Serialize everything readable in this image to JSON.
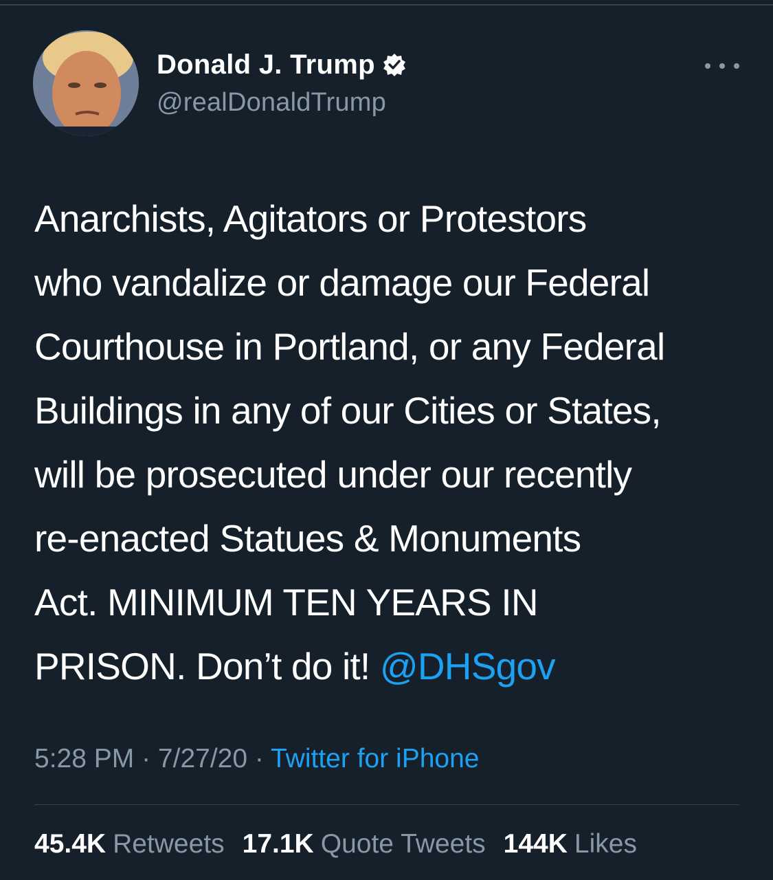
{
  "author": {
    "display_name": "Donald J. Trump",
    "handle": "@realDonaldTrump",
    "verified": true,
    "avatar_icon": "profile-photo"
  },
  "tweet": {
    "lines": [
      "Anarchists, Agitators or Protestors",
      "who vandalize or damage our Federal",
      "Courthouse in Portland, or any Federal",
      "Buildings in any of our Cities or States,",
      "will be prosecuted under our recently",
      "re-enacted Statues & Monuments",
      "Act. MINIMUM TEN YEARS IN"
    ],
    "last_line_text": "PRISON. Don’t do it! ",
    "mention": "@DHSgov"
  },
  "meta": {
    "time": "5:28 PM",
    "separator": " · ",
    "date": "7/27/20",
    "source": "Twitter for iPhone"
  },
  "stats": {
    "retweets_count": "45.4K",
    "retweets_label": "Retweets",
    "quotes_count": "17.1K",
    "quotes_label": "Quote Tweets",
    "likes_count": "144K",
    "likes_label": "Likes"
  },
  "colors": {
    "background": "#15202b",
    "accent": "#1da1f2",
    "secondary_text": "#8899a6",
    "divider": "#38444d"
  }
}
